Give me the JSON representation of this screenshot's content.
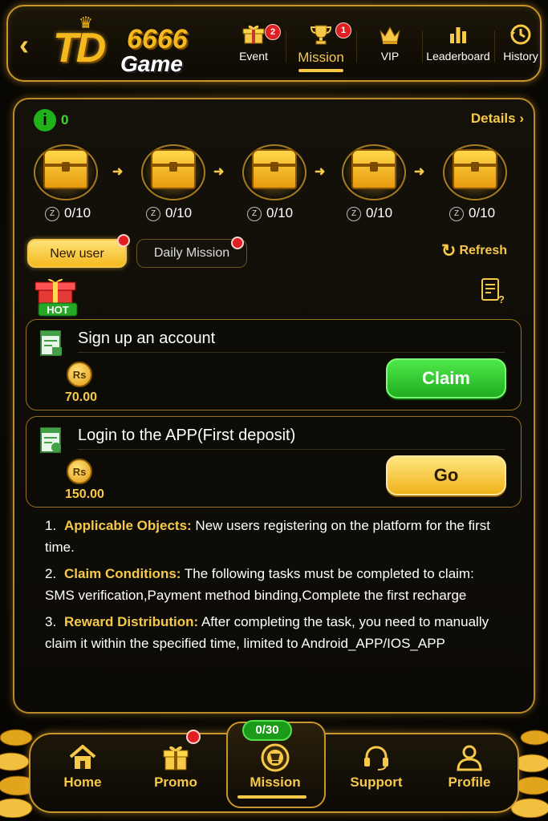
{
  "header": {
    "logo": {
      "main": "TD",
      "number": "6666",
      "sub": "Game"
    },
    "tabs": [
      {
        "label": "Event",
        "badge": "2",
        "icon": "gift-icon"
      },
      {
        "label": "Mission",
        "badge": "1",
        "icon": "trophy-icon",
        "active": true
      },
      {
        "label": "VIP",
        "icon": "crown-icon"
      },
      {
        "label": "Leaderboard",
        "icon": "bar-chart-icon"
      },
      {
        "label": "History",
        "icon": "history-icon"
      }
    ]
  },
  "progress": {
    "info_count": "0",
    "details_label": "Details",
    "chests": [
      {
        "count": "0/10"
      },
      {
        "count": "0/10"
      },
      {
        "count": "0/10"
      },
      {
        "count": "0/10"
      },
      {
        "count": "0/10"
      }
    ]
  },
  "mission_tabs": {
    "new_user": "New user",
    "daily": "Daily Mission",
    "refresh": "Refresh"
  },
  "hot_label": "HOT",
  "tasks": [
    {
      "title": "Sign up an account",
      "currency": "Rs",
      "amount": "70.00",
      "action": "Claim"
    },
    {
      "title": "Login to the APP(First deposit)",
      "currency": "Rs",
      "amount": "150.00",
      "action": "Go"
    }
  ],
  "rules": [
    {
      "num": "1.",
      "head": "Applicable Objects:",
      "text": " New users registering on the platform for the first time."
    },
    {
      "num": "2.",
      "head": "Claim Conditions:",
      "text": " The following tasks must be completed to claim: SMS verification,Payment method binding,Complete the first recharge"
    },
    {
      "num": "3.",
      "head": "Reward Distribution:",
      "text": " After completing the task, you need to manually claim it within the specified time, limited to Android_APP/IOS_APP"
    }
  ],
  "bottom_nav": {
    "mission_progress": "0/30",
    "items": [
      {
        "label": "Home",
        "icon": "home-icon"
      },
      {
        "label": "Promo",
        "icon": "gift-icon"
      },
      {
        "label": "Mission",
        "icon": "mission-badge-icon"
      },
      {
        "label": "Support",
        "icon": "headset-icon"
      },
      {
        "label": "Profile",
        "icon": "user-icon"
      }
    ]
  },
  "colors": {
    "gold": "#f7c948",
    "green": "#21b21b",
    "red": "#e02020",
    "bg": "#0b0904"
  }
}
